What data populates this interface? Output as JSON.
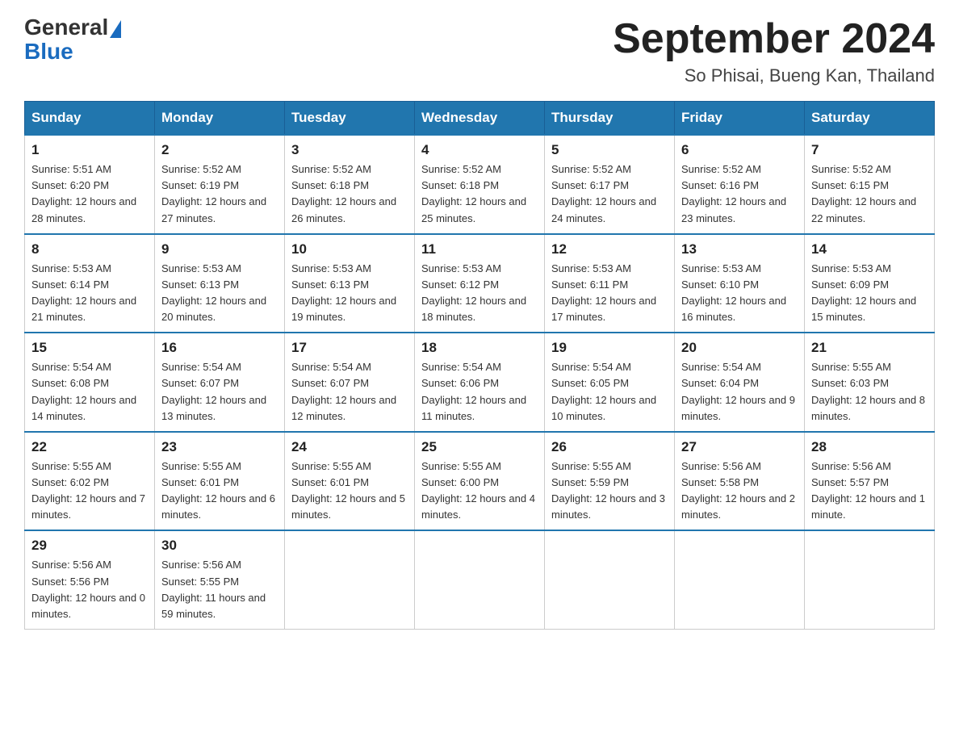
{
  "header": {
    "logo_general": "General",
    "logo_blue": "Blue",
    "title": "September 2024",
    "subtitle": "So Phisai, Bueng Kan, Thailand"
  },
  "days_of_week": [
    "Sunday",
    "Monday",
    "Tuesday",
    "Wednesday",
    "Thursday",
    "Friday",
    "Saturday"
  ],
  "weeks": [
    [
      {
        "day": "1",
        "sunrise": "5:51 AM",
        "sunset": "6:20 PM",
        "daylight": "12 hours and 28 minutes."
      },
      {
        "day": "2",
        "sunrise": "5:52 AM",
        "sunset": "6:19 PM",
        "daylight": "12 hours and 27 minutes."
      },
      {
        "day": "3",
        "sunrise": "5:52 AM",
        "sunset": "6:18 PM",
        "daylight": "12 hours and 26 minutes."
      },
      {
        "day": "4",
        "sunrise": "5:52 AM",
        "sunset": "6:18 PM",
        "daylight": "12 hours and 25 minutes."
      },
      {
        "day": "5",
        "sunrise": "5:52 AM",
        "sunset": "6:17 PM",
        "daylight": "12 hours and 24 minutes."
      },
      {
        "day": "6",
        "sunrise": "5:52 AM",
        "sunset": "6:16 PM",
        "daylight": "12 hours and 23 minutes."
      },
      {
        "day": "7",
        "sunrise": "5:52 AM",
        "sunset": "6:15 PM",
        "daylight": "12 hours and 22 minutes."
      }
    ],
    [
      {
        "day": "8",
        "sunrise": "5:53 AM",
        "sunset": "6:14 PM",
        "daylight": "12 hours and 21 minutes."
      },
      {
        "day": "9",
        "sunrise": "5:53 AM",
        "sunset": "6:13 PM",
        "daylight": "12 hours and 20 minutes."
      },
      {
        "day": "10",
        "sunrise": "5:53 AM",
        "sunset": "6:13 PM",
        "daylight": "12 hours and 19 minutes."
      },
      {
        "day": "11",
        "sunrise": "5:53 AM",
        "sunset": "6:12 PM",
        "daylight": "12 hours and 18 minutes."
      },
      {
        "day": "12",
        "sunrise": "5:53 AM",
        "sunset": "6:11 PM",
        "daylight": "12 hours and 17 minutes."
      },
      {
        "day": "13",
        "sunrise": "5:53 AM",
        "sunset": "6:10 PM",
        "daylight": "12 hours and 16 minutes."
      },
      {
        "day": "14",
        "sunrise": "5:53 AM",
        "sunset": "6:09 PM",
        "daylight": "12 hours and 15 minutes."
      }
    ],
    [
      {
        "day": "15",
        "sunrise": "5:54 AM",
        "sunset": "6:08 PM",
        "daylight": "12 hours and 14 minutes."
      },
      {
        "day": "16",
        "sunrise": "5:54 AM",
        "sunset": "6:07 PM",
        "daylight": "12 hours and 13 minutes."
      },
      {
        "day": "17",
        "sunrise": "5:54 AM",
        "sunset": "6:07 PM",
        "daylight": "12 hours and 12 minutes."
      },
      {
        "day": "18",
        "sunrise": "5:54 AM",
        "sunset": "6:06 PM",
        "daylight": "12 hours and 11 minutes."
      },
      {
        "day": "19",
        "sunrise": "5:54 AM",
        "sunset": "6:05 PM",
        "daylight": "12 hours and 10 minutes."
      },
      {
        "day": "20",
        "sunrise": "5:54 AM",
        "sunset": "6:04 PM",
        "daylight": "12 hours and 9 minutes."
      },
      {
        "day": "21",
        "sunrise": "5:55 AM",
        "sunset": "6:03 PM",
        "daylight": "12 hours and 8 minutes."
      }
    ],
    [
      {
        "day": "22",
        "sunrise": "5:55 AM",
        "sunset": "6:02 PM",
        "daylight": "12 hours and 7 minutes."
      },
      {
        "day": "23",
        "sunrise": "5:55 AM",
        "sunset": "6:01 PM",
        "daylight": "12 hours and 6 minutes."
      },
      {
        "day": "24",
        "sunrise": "5:55 AM",
        "sunset": "6:01 PM",
        "daylight": "12 hours and 5 minutes."
      },
      {
        "day": "25",
        "sunrise": "5:55 AM",
        "sunset": "6:00 PM",
        "daylight": "12 hours and 4 minutes."
      },
      {
        "day": "26",
        "sunrise": "5:55 AM",
        "sunset": "5:59 PM",
        "daylight": "12 hours and 3 minutes."
      },
      {
        "day": "27",
        "sunrise": "5:56 AM",
        "sunset": "5:58 PM",
        "daylight": "12 hours and 2 minutes."
      },
      {
        "day": "28",
        "sunrise": "5:56 AM",
        "sunset": "5:57 PM",
        "daylight": "12 hours and 1 minute."
      }
    ],
    [
      {
        "day": "29",
        "sunrise": "5:56 AM",
        "sunset": "5:56 PM",
        "daylight": "12 hours and 0 minutes."
      },
      {
        "day": "30",
        "sunrise": "5:56 AM",
        "sunset": "5:55 PM",
        "daylight": "11 hours and 59 minutes."
      },
      null,
      null,
      null,
      null,
      null
    ]
  ]
}
